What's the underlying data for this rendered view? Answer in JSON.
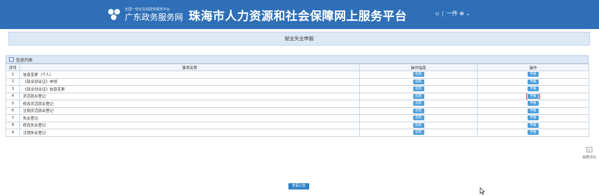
{
  "header": {
    "gd_top_line": "全国一体化在线政务服务平台",
    "gd_name": "广东政务服务网",
    "site_title": "珠海市人力资源和社会保障网上服务平台",
    "right_text_1": "▫",
    "right_text_2": "一件 ⊕ ⌄",
    "separator": "|",
    "icon_color": "#ffffff",
    "bg_color": "#2e6fb8"
  },
  "page_title": "就业失业申报",
  "list": {
    "title": "信息列表",
    "columns": [
      "序号",
      "事项名称",
      "操作指南",
      "操作"
    ],
    "guide_label": "指南",
    "action_label": "申报",
    "rows": [
      {
        "no": "1",
        "name": "信息变更（个人）"
      },
      {
        "no": "2",
        "name": "《就业创业证》申领"
      },
      {
        "no": "3",
        "name": "《就业创业证》信息变更"
      },
      {
        "no": "4",
        "name": "灵活就业登记"
      },
      {
        "no": "5",
        "name": "修改灵活就业登记"
      },
      {
        "no": "6",
        "name": "注销灵活就业登记"
      },
      {
        "no": "7",
        "name": "失业登记"
      },
      {
        "no": "8",
        "name": "修改失业登记"
      },
      {
        "no": "9",
        "name": "注销失业登记"
      }
    ],
    "highlighted_row": "4",
    "highlight_color": "#e5262a",
    "button_color": "#4f9fdb"
  },
  "notice_button": "查看公告",
  "feedback_label": "我要评价"
}
